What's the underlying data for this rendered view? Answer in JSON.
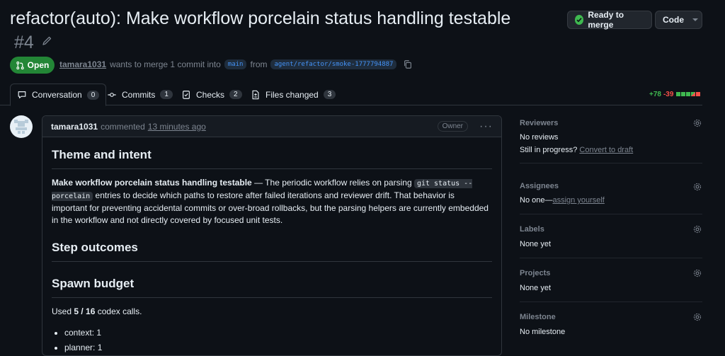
{
  "pr": {
    "title": "refactor(auto): Make workflow porcelain status handling testable",
    "number": "#4",
    "state": "Open",
    "author": "tamara1031",
    "merge_text_1": "wants to merge 1 commit into",
    "base_branch": "main",
    "from_text": "from",
    "head_branch": "agent/refactor/smoke-1777794887"
  },
  "header_buttons": {
    "merge": "Ready to merge",
    "code": "Code"
  },
  "tabs": [
    {
      "label": "Conversation",
      "count": "0",
      "icon": "comment-icon"
    },
    {
      "label": "Commits",
      "count": "1",
      "icon": "commit-icon"
    },
    {
      "label": "Checks",
      "count": "2",
      "icon": "checks-icon"
    },
    {
      "label": "Files changed",
      "count": "3",
      "icon": "file-diff-icon"
    }
  ],
  "diffstat": {
    "additions": "+78",
    "deletions": "-39"
  },
  "comment": {
    "author": "tamara1031",
    "verb": "commented",
    "time": "13 minutes ago",
    "role": "Owner",
    "h_theme": "Theme and intent",
    "p1_bold": "Make workflow porcelain status handling testable",
    "p1_text_a": " — The periodic workflow relies on parsing ",
    "p1_code": "git status --porcelain",
    "p1_text_b": " entries to decide which paths to restore after failed iterations and reviewer drift. That behavior is important for preventing accidental commits or over-broad rollbacks, but the parsing helpers are currently embedded in the workflow and not directly covered by focused unit tests.",
    "h_step": "Step outcomes",
    "h_spawn": "Spawn budget",
    "budget_a": "Used ",
    "budget_bold": "5 / 16",
    "budget_b": " codex calls.",
    "bullets": [
      "context: 1",
      "planner: 1"
    ]
  },
  "sidebar": {
    "reviewers": {
      "title": "Reviewers",
      "value": "No reviews",
      "progress_text": "Still in progress?",
      "progress_link": "Convert to draft"
    },
    "assignees": {
      "title": "Assignees",
      "value": "No one—",
      "link": "assign yourself"
    },
    "labels": {
      "title": "Labels",
      "value": "None yet"
    },
    "projects": {
      "title": "Projects",
      "value": "None yet"
    },
    "milestone": {
      "title": "Milestone",
      "value": "No milestone"
    }
  },
  "colors": {
    "open_green": "#238636",
    "accent_blue": "#4493f8",
    "background": "#0d1117"
  }
}
